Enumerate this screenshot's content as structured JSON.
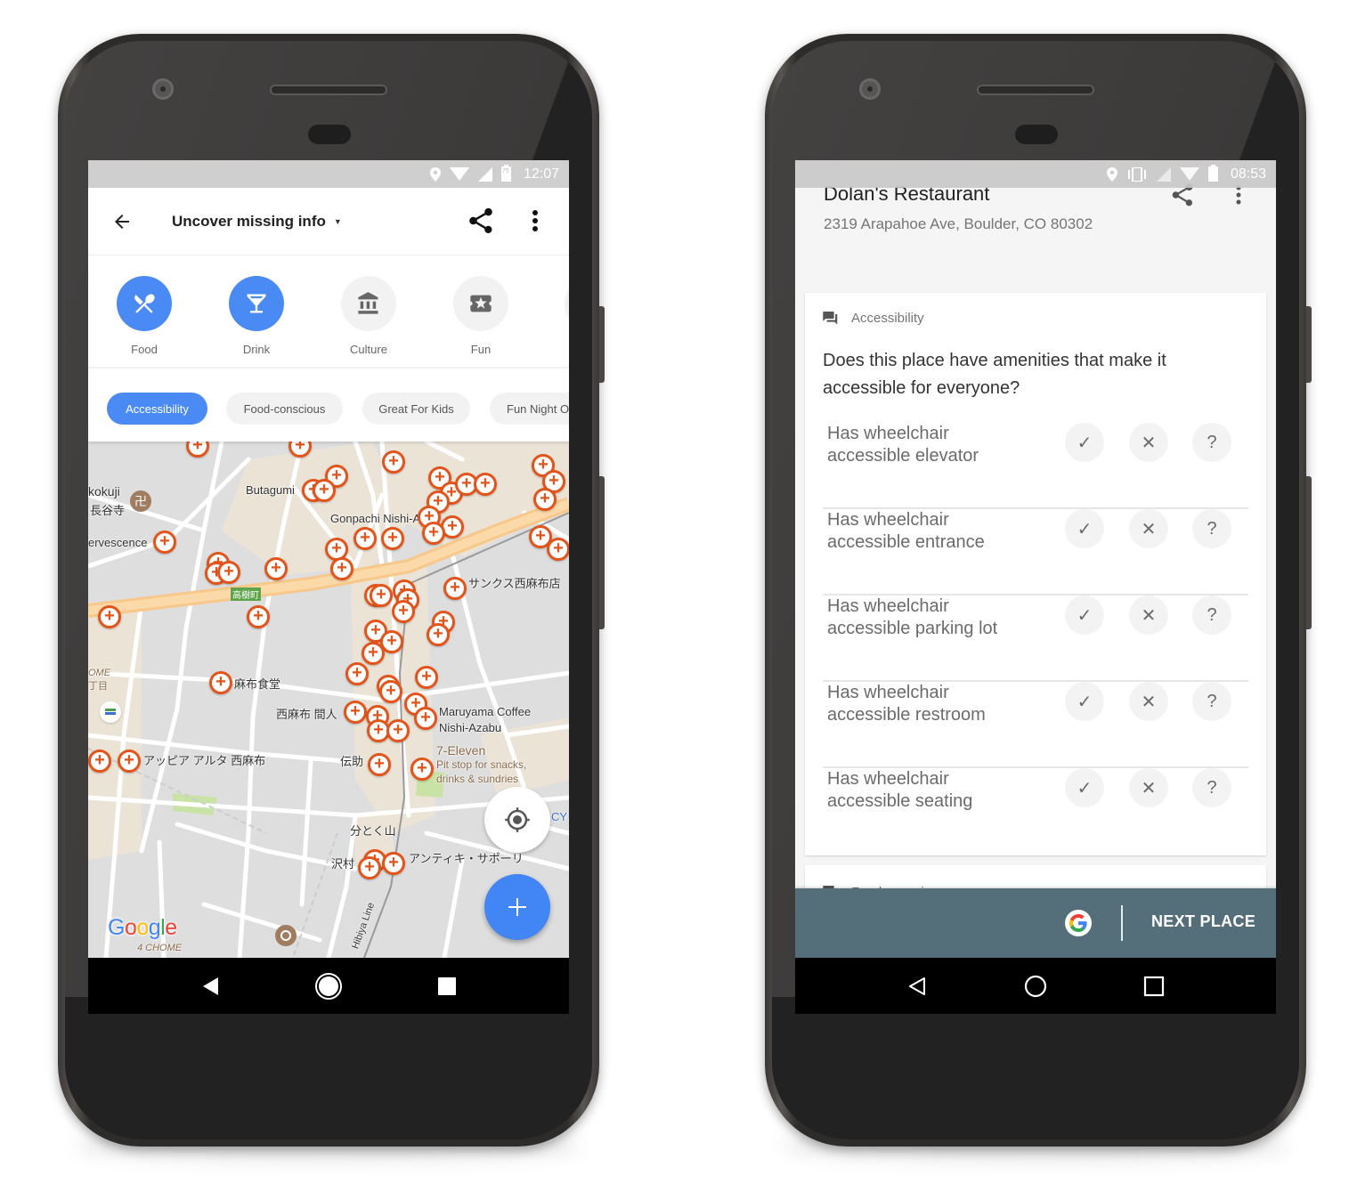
{
  "left_phone": {
    "status_bar": {
      "time": "12:07",
      "battery_level": "75",
      "icons": [
        "location-icon",
        "wifi-icon",
        "signal-icon",
        "battery-icon"
      ]
    },
    "app_bar": {
      "title": "Uncover missing info",
      "back_icon": "arrow-left-icon",
      "share_icon": "share-icon",
      "more_icon": "more-vert-icon"
    },
    "categories": [
      {
        "label": "Food",
        "icon": "fork-spoon-icon",
        "active": true
      },
      {
        "label": "Drink",
        "icon": "cocktail-icon",
        "active": true
      },
      {
        "label": "Culture",
        "icon": "museum-icon",
        "active": false
      },
      {
        "label": "Fun",
        "icon": "ticket-star-icon",
        "active": false
      }
    ],
    "chips": [
      {
        "label": "Accessibility",
        "active": true
      },
      {
        "label": "Food-conscious",
        "active": false
      },
      {
        "label": "Great For Kids",
        "active": false
      },
      {
        "label": "Fun Night O",
        "active": false
      }
    ],
    "map": {
      "labels": [
        "kokuji",
        "長谷寺",
        "Butagumi",
        "Gonpachi Nishi-A",
        "ervescence",
        "高樹町",
        "サンクス西麻布店",
        "OME",
        "丁目",
        "麻布食堂",
        "西麻布 間人",
        "Maruyama Coffee",
        "Nishi-Azabu",
        "アッピア アルタ 西麻布",
        "伝助",
        "7-Eleven",
        "Pit stop for snacks,",
        "drinks & sundries",
        "分とく山",
        "沢村",
        "アンティキ・サポーリ",
        "CY",
        "Hibiya Line",
        "4 CHOME"
      ],
      "google_logo": "Google",
      "fab_icon": "plus-icon",
      "locate_icon": "my-location-icon",
      "pin_glyph": "+"
    },
    "nav_bar": {
      "back": "back-icon",
      "home": "home-icon",
      "recents": "recents-icon"
    }
  },
  "right_phone": {
    "status_bar": {
      "time": "08:53",
      "icons": [
        "location-icon",
        "vibrate-icon",
        "signal-icon",
        "wifi-icon",
        "battery-icon"
      ]
    },
    "place": {
      "name": "Dolan's Restaurant",
      "address": "2319 Arapahoe Ave, Boulder, CO 80302"
    },
    "question_card": {
      "category": "Accessibility",
      "question": "Does this place have amenities that make it accessible for everyone?",
      "answers": {
        "yes": "✓",
        "no": "✕",
        "unknown": "?"
      },
      "rows": [
        {
          "line1": "Has wheelchair",
          "line2": "accessible elevator"
        },
        {
          "line1": "Has wheelchair",
          "line2": "accessible entrance"
        },
        {
          "line1": "Has wheelchair",
          "line2": "accessible parking lot"
        },
        {
          "line1": "Has wheelchair",
          "line2": "accessible restroom"
        },
        {
          "line1": "Has wheelchair",
          "line2": "accessible seating"
        }
      ]
    },
    "next_card": {
      "category": "Food-conscious"
    },
    "bottom_bar": {
      "google_badge": "G",
      "next_label": "NEXT PLACE",
      "color": "#546e7a"
    }
  },
  "colors": {
    "accent_blue": "#4a8af4",
    "pin_orange": "#e3541b",
    "fab_blue": "#4285f4"
  }
}
